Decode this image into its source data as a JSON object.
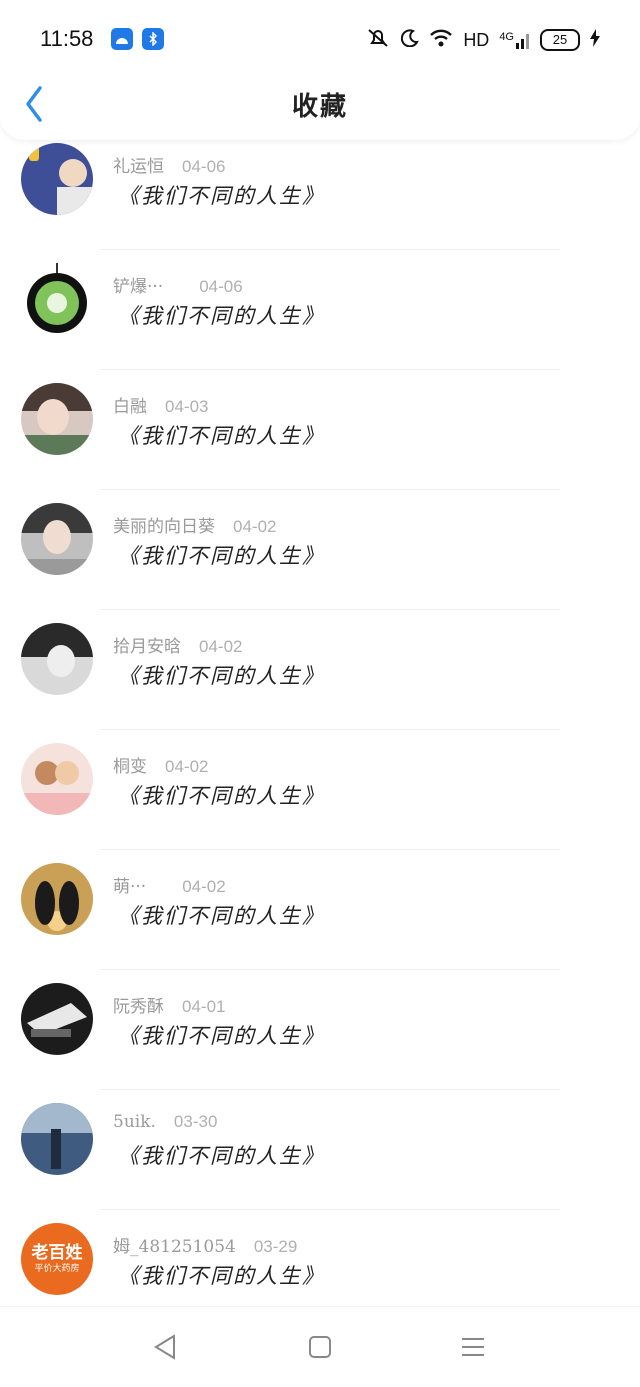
{
  "status": {
    "time": "11:58",
    "network": "HD",
    "signal_type": "4G",
    "battery": "25"
  },
  "header": {
    "title": "收藏"
  },
  "items": [
    {
      "user": "礼运恒",
      "date": "04-06",
      "book": "《我们不同的人生》"
    },
    {
      "user": "铲爆···",
      "date": "04-06",
      "book": "《我们不同的人生》"
    },
    {
      "user": "白融",
      "date": "04-03",
      "book": "《我们不同的人生》"
    },
    {
      "user": "美丽的向日葵",
      "date": "04-02",
      "book": "《我们不同的人生》"
    },
    {
      "user": "拾月安晗",
      "date": "04-02",
      "book": "《我们不同的人生》"
    },
    {
      "user": "桐变",
      "date": "04-02",
      "book": "《我们不同的人生》"
    },
    {
      "user": "萌···",
      "date": "04-02",
      "book": "《我们不同的人生》"
    },
    {
      "user": "阮秀酥",
      "date": "04-01",
      "book": "《我们不同的人生》"
    },
    {
      "user": "5uik.",
      "date": "03-30",
      "book": "《我们不同的人生》"
    },
    {
      "user": "姆_481251054",
      "date": "03-29",
      "book": "《我们不同的人生》"
    }
  ],
  "avatar_10_text": {
    "line1": "老百姓",
    "line2": "平价大药房"
  },
  "colors": {
    "accent": "#2f8fe6",
    "text": "#222222",
    "meta": "#9a9a9a"
  },
  "icons": {
    "back": "chevron-left-icon",
    "nav_back": "triangle-left-icon",
    "nav_home": "square-icon",
    "nav_menu": "hamburger-icon"
  }
}
